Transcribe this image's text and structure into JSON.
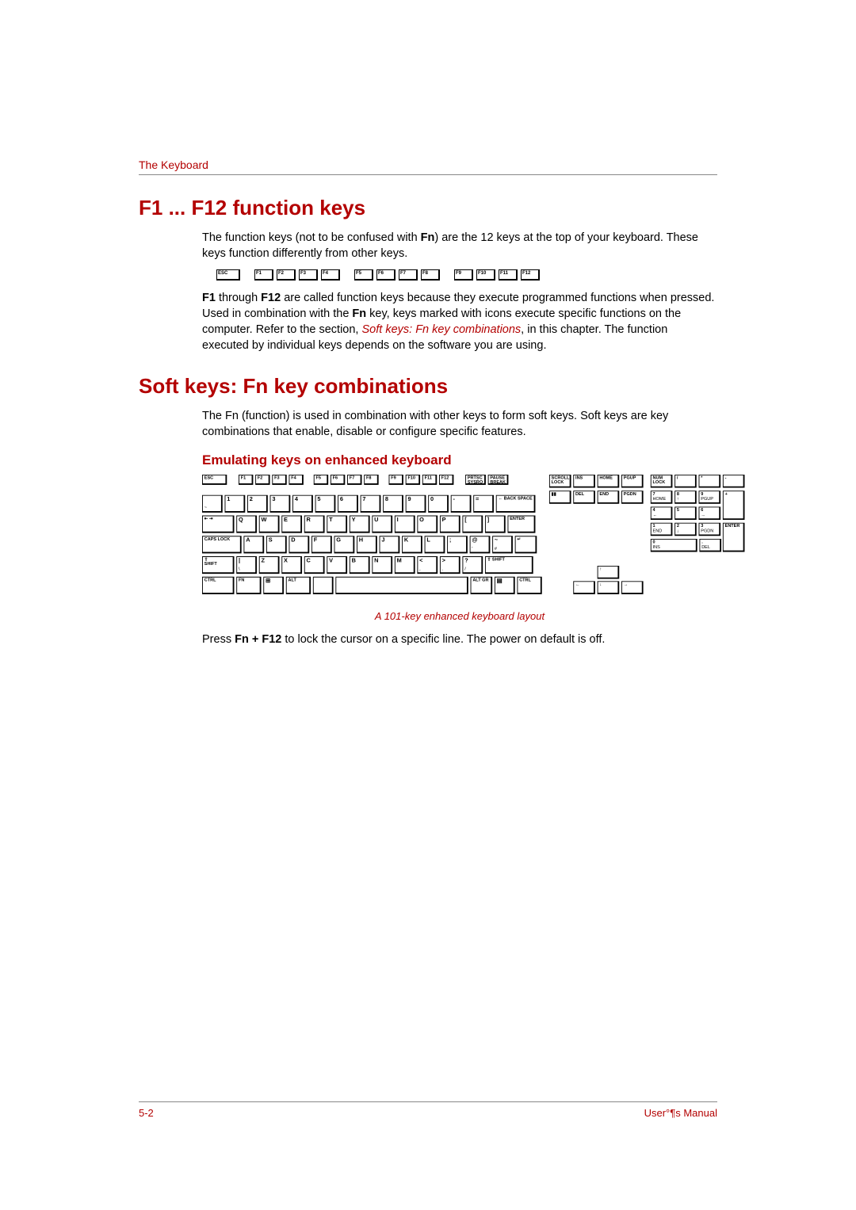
{
  "header": {
    "title": "The Keyboard"
  },
  "section1": {
    "heading": "F1 ... F12 function keys",
    "p1_a": "The function keys (not to be confused with ",
    "p1_b": "Fn",
    "p1_c": ") are the 12 keys at the top of your keyboard. These keys function differently from other keys.",
    "p2_a": "F1",
    "p2_b": " through ",
    "p2_c": "F12",
    "p2_d": " are called function keys because they execute programmed functions when pressed. Used in combination with the ",
    "p2_e": "Fn",
    "p2_f": " key, keys marked with icons execute specific functions on the computer. Refer to the section, ",
    "p2_link": "Soft keys: Fn key combinations",
    "p2_g": ", in this chapter. The function executed by individual keys depends on the software you are using."
  },
  "section2": {
    "heading": "Soft keys: Fn key combinations",
    "p1": "The Fn (function) is used in combination with other keys to form soft keys. Soft keys are key combinations that enable, disable or configure specific features.",
    "sub1": "Emulating keys on enhanced keyboard",
    "caption": "A 101-key enhanced keyboard layout",
    "p2_a": "Press ",
    "p2_b": "Fn + F12",
    "p2_c": " to lock the cursor on a specific line. The power on default is off."
  },
  "fnrow": {
    "esc": "ESC",
    "keys": [
      "F1",
      "F2",
      "F3",
      "F4",
      "F5",
      "F6",
      "F7",
      "F8",
      "F9",
      "F10",
      "F11",
      "F12"
    ]
  },
  "kbd": {
    "row0": {
      "esc": "ESC",
      "f": [
        "F1",
        "F2",
        "F3",
        "F4",
        "F5",
        "F6",
        "F7",
        "F8",
        "F9",
        "F10",
        "F11",
        "F12"
      ],
      "prtsc": "PRTSC SYSRQ",
      "pause": "PAUSE BREAK"
    },
    "row1": {
      "tilde": "~",
      "nums": [
        "1",
        "2",
        "3",
        "4",
        "5",
        "6",
        "7",
        "8",
        "9",
        "0"
      ],
      "minus": "-",
      "eq": "=",
      "back": "BACK SPACE",
      "backArrow": "←"
    },
    "row2": {
      "tab": "⇤\n⇥",
      "q": "Q",
      "w": "W",
      "e": "E",
      "r": "R",
      "t": "T",
      "y": "Y",
      "u": "U",
      "i": "I",
      "o": "O",
      "p": "P",
      "lb": "[",
      "rb": "]",
      "enter": "ENTER"
    },
    "row3": {
      "caps": "CAPS LOCK",
      "a": "A",
      "s": "S",
      "d": "D",
      "f": "F",
      "g": "G",
      "h": "H",
      "j": "J",
      "k": "K",
      "l": "L",
      "sc": ";",
      "qt": "'",
      "bs": "\\",
      "pipe": "|",
      "at": "@",
      "hash": "#",
      "tilde2": "~"
    },
    "row4": {
      "shift": "SHIFT",
      "lt": "<",
      "z": "Z",
      "x": "X",
      "c": "C",
      "v": "V",
      "b": "B",
      "n": "N",
      "m": "M",
      "cm": ",",
      "pd": ".",
      "sl": "/",
      "shiftR": "SHIFT",
      "shiftIcon": "⇧"
    },
    "row5": {
      "ctrl": "CTRL",
      "fn": "FN",
      "win": "⊞",
      "alt": "ALT",
      "muhenkan": "",
      "space": "",
      "altgr": "ALT GR",
      "menu": "▤",
      "ctrlR": "CTRL"
    },
    "nav": {
      "scrlk": "SCROLL LOCK",
      "ins": "INS",
      "home": "HOME",
      "pgup": "PGUP",
      "pause": "",
      "del": "DEL",
      "end": "END",
      "pgdn": "PGDN",
      "up": "↑",
      "down": "↓",
      "left": "←",
      "right": "→"
    },
    "num": {
      "numlk": "NUM LOCK",
      "div": "/",
      "mul": "*",
      "sub": "-",
      "7": "7",
      "8": "8",
      "9": "9",
      "home": "HOME",
      "up": "↑",
      "pgup": "PGUP",
      "4": "4",
      "5": "5",
      "6": "6",
      "left": "←",
      "right": "→",
      "add": "+",
      "1": "1",
      "2": "2",
      "3": "3",
      "end": "END",
      "dn": "↓",
      "pgdn": "PGDN",
      "0": "0",
      "ins": "INS",
      "dot": ".",
      "del": "DEL",
      "enter": "ENTER"
    }
  },
  "footer": {
    "left": "5-2",
    "right": "User°¶s Manual"
  }
}
